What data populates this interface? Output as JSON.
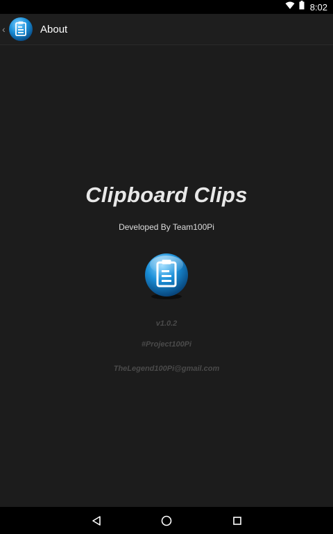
{
  "status_bar": {
    "time": "8:02",
    "icons": [
      "wifi-icon",
      "battery-icon"
    ]
  },
  "action_bar": {
    "title": "About",
    "icon": "clipboard-app-icon"
  },
  "about": {
    "app_name": "Clipboard Clips",
    "developer": "Developed By Team100Pi",
    "version": "v1.0.2",
    "hashtag": "#Project100Pi",
    "email": "TheLegend100Pi@gmail.com"
  },
  "nav_bar": {
    "buttons": [
      "back-icon",
      "home-icon",
      "recents-icon"
    ]
  },
  "colors": {
    "accent_blue": "#1a8fd8",
    "background": "#1c1c1c",
    "muted_text": "#4a4a4a"
  }
}
